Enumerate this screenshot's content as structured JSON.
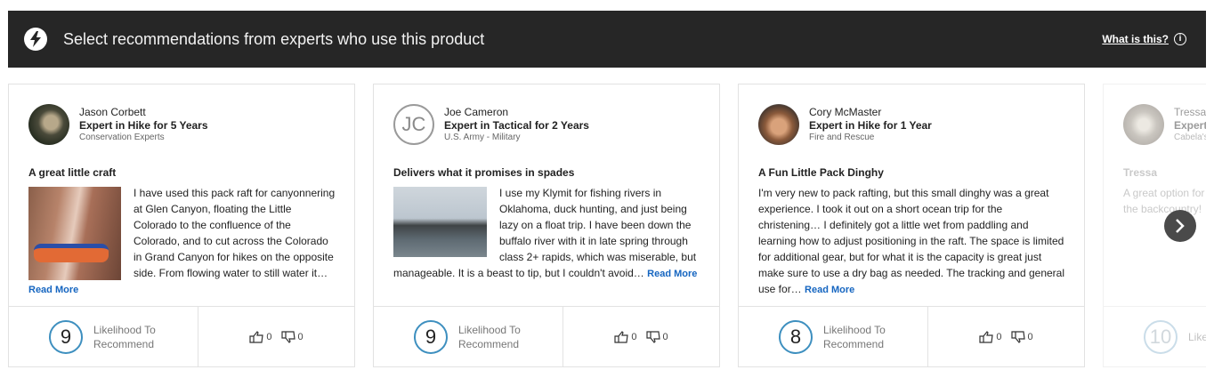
{
  "banner": {
    "title": "Select recommendations from experts who use this product",
    "what_link": "What is this?",
    "info_glyph": "i"
  },
  "colors": {
    "banner_bg": "#262626",
    "link": "#1565c0",
    "score_ring": "#3d8fbf"
  },
  "likelihood_label": "Likelihood To Recommend",
  "read_more": "Read More",
  "cards": [
    {
      "author": "Jason Corbett",
      "expert": "Expert in Hike for 5 Years",
      "org": "Conservation Experts",
      "title": "A great little craft",
      "body": "I have used this pack raft for canyonnering at Glen Canyon, floating the Little Colorado to the confluence of the Colorado, and to cut across the Colorado in Grand Canyon for hikes on the opposite side. From flowing water to still water it…",
      "score": "9",
      "up": "0",
      "down": "0"
    },
    {
      "author": "Joe Cameron",
      "initials": "JC",
      "expert": "Expert in Tactical for 2 Years",
      "org": "U.S. Army - Military",
      "title": "Delivers what it promises in spades",
      "body": "I use my Klymit for fishing rivers in Oklahoma, duck hunting, and just being lazy on a float trip. I have been down the buffalo river with it in late spring through class 2+ rapids, which was miserable, but manageable. It is a beast to tip, but I couldn't avoid…",
      "score": "9",
      "up": "0",
      "down": "0"
    },
    {
      "author": "Cory McMaster",
      "expert": "Expert in Hike for 1 Year",
      "org": "Fire and Rescue",
      "title": "A Fun Little Pack Dinghy",
      "body": "I'm very new to pack rafting, but this small dinghy was a great experience. I took it out on a short ocean trip for the christening… I definitely got a little wet from paddling and learning how to adjust positioning in the raft. The space is limited for additional gear, but for what it is the capacity is great just make sure to use a dry bag as needed. The tracking and general use for…",
      "score": "8",
      "up": "0",
      "down": "0"
    },
    {
      "author": "Tressa",
      "expert": "Expert",
      "org": "Cabela's",
      "title": "Tressa",
      "body": "A great option for the backcountry!",
      "score": "10",
      "label_partial": "Like Rec"
    }
  ]
}
